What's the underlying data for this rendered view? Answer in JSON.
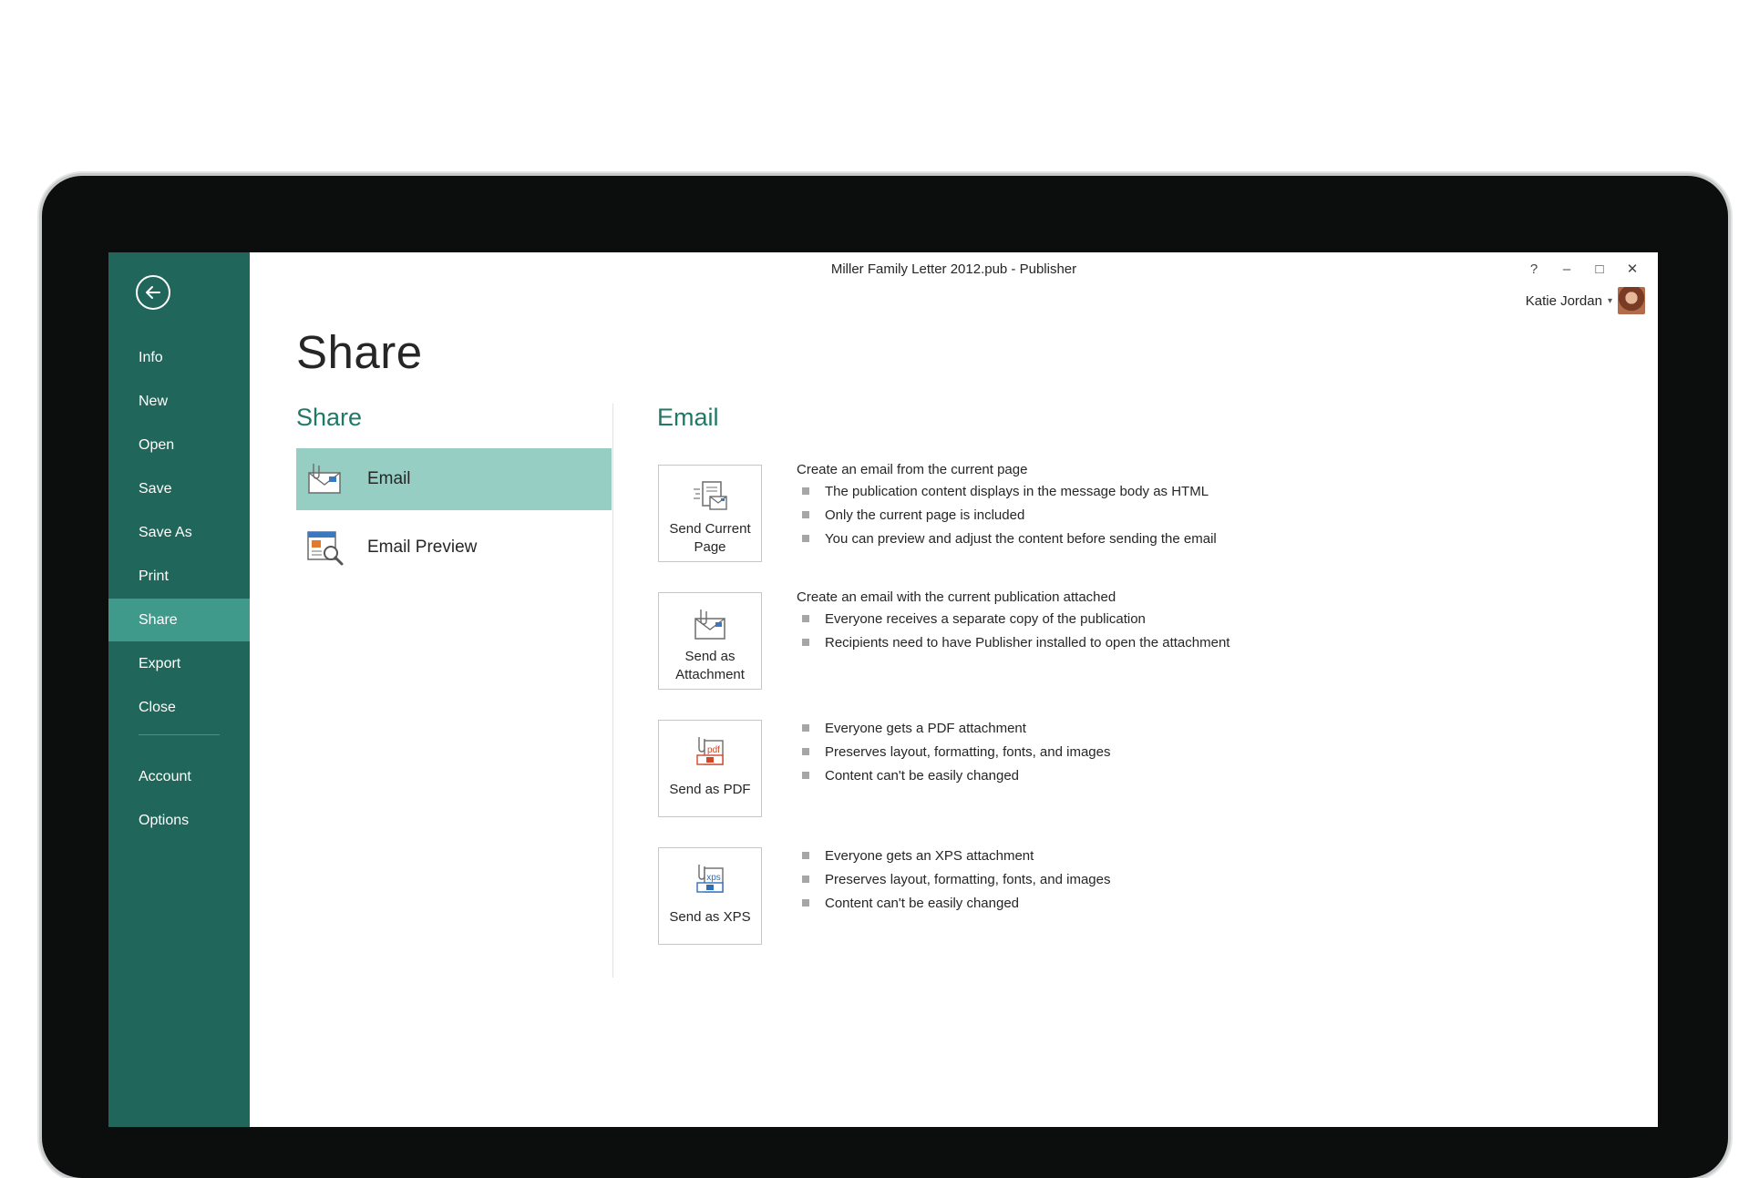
{
  "window": {
    "title": "Miller Family Letter 2012.pub - Publisher",
    "controls": [
      "?",
      "–",
      "□",
      "✕"
    ],
    "user_name": "Katie Jordan",
    "user_caret": "▾"
  },
  "sidebar": {
    "items": [
      {
        "label": "Info"
      },
      {
        "label": "New"
      },
      {
        "label": "Open"
      },
      {
        "label": "Save"
      },
      {
        "label": "Save As"
      },
      {
        "label": "Print"
      },
      {
        "label": "Share",
        "active": true
      },
      {
        "label": "Export"
      },
      {
        "label": "Close"
      },
      {
        "label": "Account"
      },
      {
        "label": "Options"
      }
    ]
  },
  "page": {
    "title": "Share",
    "left_heading": "Share",
    "right_heading": "Email"
  },
  "share_list": [
    {
      "label": "Email",
      "icon": "email-icon",
      "selected": true
    },
    {
      "label": "Email Preview",
      "icon": "email-preview-icon",
      "selected": false
    }
  ],
  "options": [
    {
      "button_label": [
        "Send Current",
        "Page"
      ],
      "icon": "send-current-page-icon",
      "intro": "Create an email from the current page",
      "bullets": [
        "The publication content displays in the message body as HTML",
        "Only the current page is included",
        "You can preview and adjust the content before sending the email"
      ]
    },
    {
      "button_label": [
        "Send as",
        "Attachment"
      ],
      "icon": "send-as-attachment-icon",
      "intro": "Create an email with the current publication attached",
      "bullets": [
        "Everyone receives a separate copy of the publication",
        "Recipients need to have Publisher installed to open the attachment"
      ]
    },
    {
      "button_label": [
        "Send as PDF"
      ],
      "icon": "send-as-pdf-icon",
      "icon_text": "pdf",
      "intro": "",
      "bullets": [
        "Everyone gets a PDF attachment",
        "Preserves layout, formatting, fonts, and images",
        "Content can't be easily changed"
      ]
    },
    {
      "button_label": [
        "Send as XPS"
      ],
      "icon": "send-as-xps-icon",
      "icon_text": "xps",
      "intro": "",
      "bullets": [
        "Everyone gets an XPS attachment",
        "Preserves layout, formatting, fonts, and images",
        "Content can't be easily changed"
      ]
    }
  ],
  "colors": {
    "sidebar": "#21665a",
    "sidebar_active": "#3f9a8b",
    "selected_item": "#97cec4",
    "heading": "#1e7a66",
    "pdf_accent": "#d24726",
    "xps_accent": "#2e6fb7"
  }
}
